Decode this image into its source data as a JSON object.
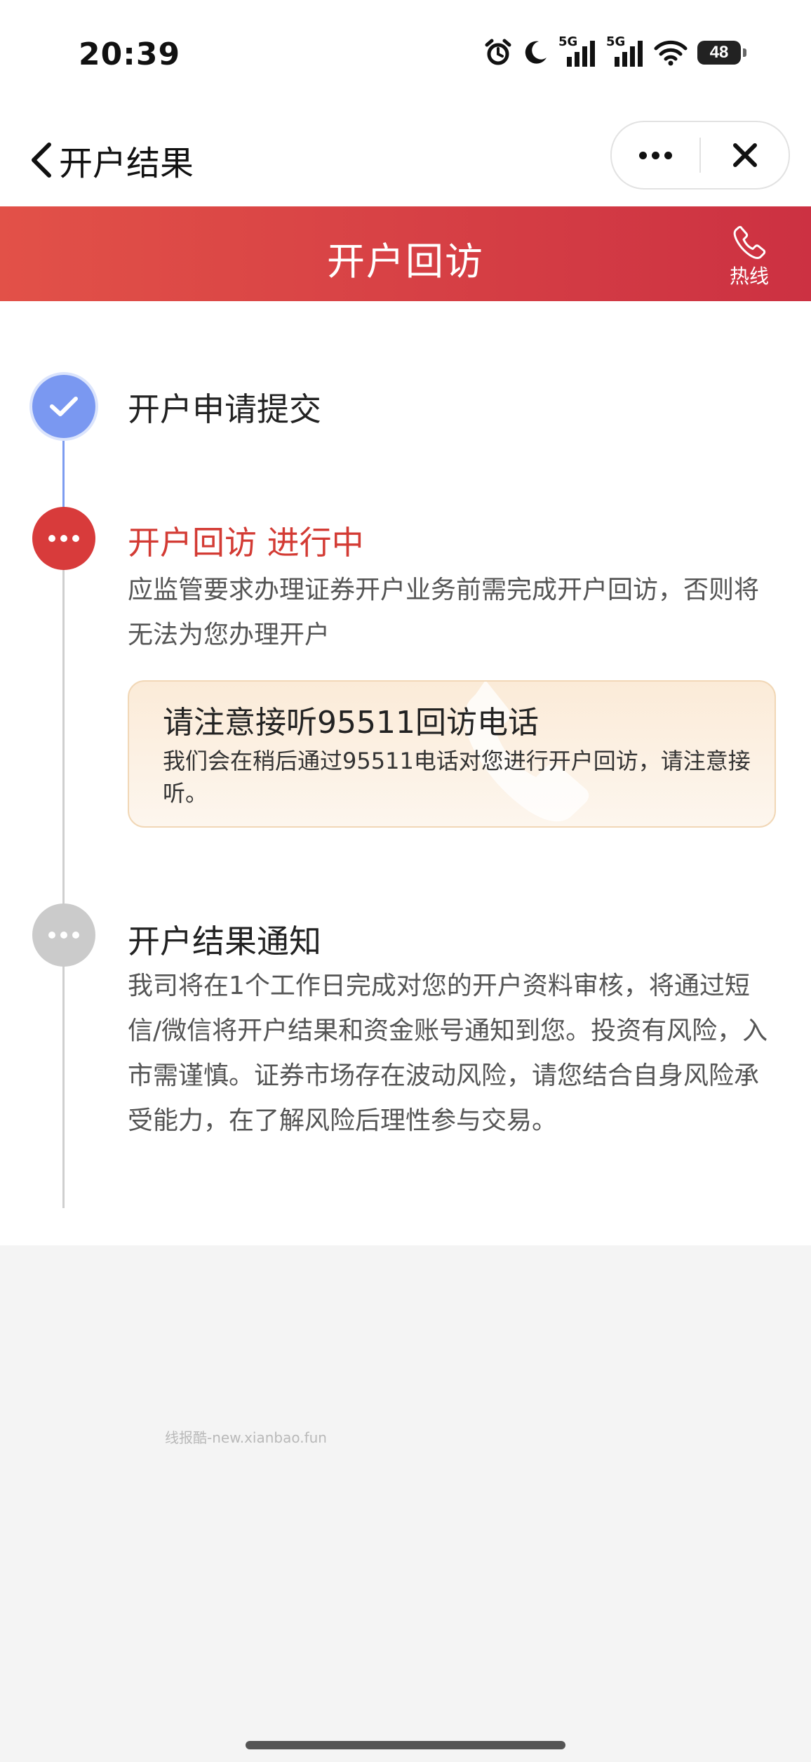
{
  "status_bar": {
    "time": "20:39",
    "battery": "48",
    "network_1": "5G",
    "network_2": "5G"
  },
  "nav": {
    "title": "开户结果"
  },
  "banner": {
    "title": "开户回访",
    "hotline_label": "热线"
  },
  "steps": [
    {
      "title": "开户申请提交",
      "status": "done"
    },
    {
      "title": "开户回访 进行中",
      "status": "active",
      "description": "应监管要求办理证券开户业务前需完成开户回访，否则将无法为您办理开户",
      "notice": {
        "title": "请注意接听95511回访电话",
        "text": "我们会在稍后通过95511电话对您进行开户回访，请注意接听。"
      }
    },
    {
      "title": "开户结果通知",
      "status": "pending",
      "description": "我司将在1个工作日完成对您的开户资料审核，将通过短信/微信将开户结果和资金账号通知到您。投资有风险，入市需谨慎。证券市场存在波动风险，请您结合自身风险承受能力，在了解风险后理性参与交易。"
    }
  ],
  "watermark": "线报酷-new.xianbao.fun",
  "colors": {
    "accent_red": "#d33b34",
    "banner_start": "#e25148",
    "banner_end": "#cc3142",
    "done_blue": "#7a98f1",
    "pending_grey": "#cbcbcb"
  }
}
